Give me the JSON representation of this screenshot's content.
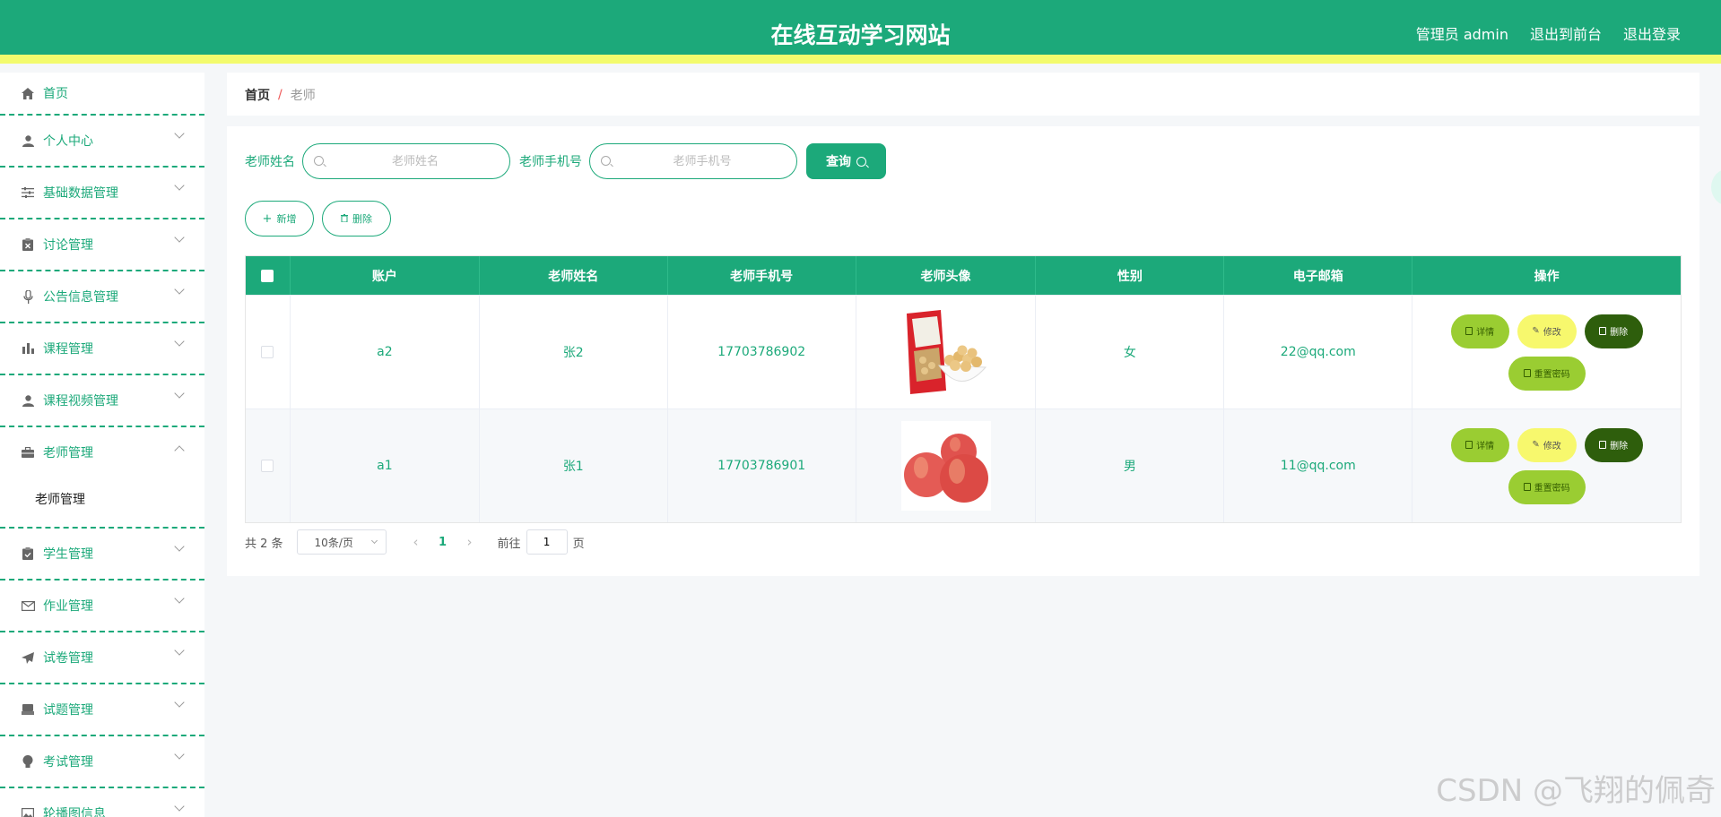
{
  "header": {
    "title": "在线互动学习网站",
    "user_label": "管理员 admin",
    "front_link": "退出到前台",
    "logout_link": "退出登录"
  },
  "sidebar": {
    "items": [
      {
        "label": "首页",
        "icon": "home-icon"
      },
      {
        "label": "个人中心",
        "icon": "user-icon"
      },
      {
        "label": "基础数据管理",
        "icon": "sliders-icon"
      },
      {
        "label": "讨论管理",
        "icon": "clipboard-x-icon"
      },
      {
        "label": "公告信息管理",
        "icon": "microphone-icon"
      },
      {
        "label": "课程管理",
        "icon": "bar-chart-icon"
      },
      {
        "label": "课程视频管理",
        "icon": "user-icon"
      },
      {
        "label": "老师管理",
        "icon": "briefcase-icon"
      },
      {
        "label": "学生管理",
        "icon": "clipboard-check-icon"
      },
      {
        "label": "作业管理",
        "icon": "envelope-icon"
      },
      {
        "label": "试卷管理",
        "icon": "paper-plane-icon"
      },
      {
        "label": "试题管理",
        "icon": "inbox-icon"
      },
      {
        "label": "考试管理",
        "icon": "bulb-icon"
      },
      {
        "label": "轮播图信息",
        "icon": "image-icon"
      }
    ],
    "submenu_teacher": "老师管理"
  },
  "breadcrumb": {
    "home": "首页",
    "separator": "/",
    "current": "老师"
  },
  "search": {
    "name_label": "老师姓名",
    "name_placeholder": "老师姓名",
    "phone_label": "老师手机号",
    "phone_placeholder": "老师手机号",
    "query_button": "查询"
  },
  "actions": {
    "add": "新增",
    "delete": "删除"
  },
  "table": {
    "columns": [
      "账户",
      "老师姓名",
      "老师手机号",
      "老师头像",
      "性别",
      "电子邮箱",
      "操作"
    ],
    "rows": [
      {
        "account": "a2",
        "name": "张2",
        "phone": "17703786902",
        "avatar": "snack-bag-image",
        "gender": "女",
        "email": "22@qq.com"
      },
      {
        "account": "a1",
        "name": "张1",
        "phone": "17703786901",
        "avatar": "apples-image",
        "gender": "男",
        "email": "11@qq.com"
      }
    ],
    "row_actions": {
      "detail": "详情",
      "edit": "修改",
      "delete": "删除",
      "reset": "重置密码"
    }
  },
  "pagination": {
    "total": "共 2 条",
    "page_size": "10条/页",
    "current_page": "1",
    "goto_label": "前往",
    "goto_value": "1",
    "page_suffix": "页"
  },
  "watermark": "CSDN @飞翔的佩奇",
  "colors": {
    "primary": "#1ca97a",
    "accent_yellow": "#f3fb6d",
    "detail_green": "#9acd32",
    "edit_yellow": "#f7f86d",
    "delete_dark": "#2e5e0c"
  }
}
